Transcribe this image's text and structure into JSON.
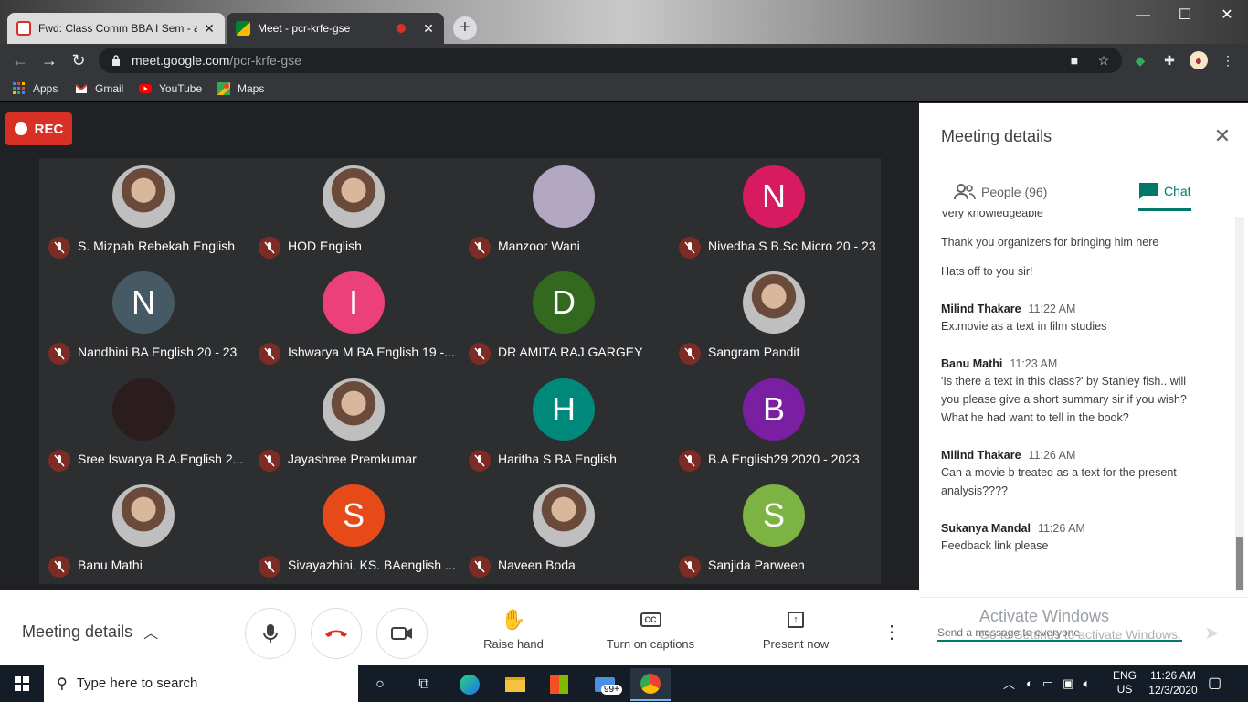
{
  "browser": {
    "tabs": [
      {
        "title": "Fwd: Class Comm BBA I Sem - an",
        "active": false
      },
      {
        "title": "Meet - pcr-krfe-gse",
        "active": true
      }
    ],
    "url_host": "meet.google.com",
    "url_path": "/pcr-krfe-gse",
    "bookmarks": [
      "Apps",
      "Gmail",
      "YouTube",
      "Maps"
    ]
  },
  "meet": {
    "rec_label": "REC",
    "participants": [
      {
        "name": "S. Mizpah Rebekah English",
        "initial": "",
        "color": ""
      },
      {
        "name": "HOD English",
        "initial": "",
        "color": ""
      },
      {
        "name": "Manzoor Wani",
        "initial": "",
        "color": "#b3a8c4"
      },
      {
        "name": "Nivedha.S B.Sc Micro 20 - 23",
        "initial": "N",
        "color": "#d81b60"
      },
      {
        "name": "Nandhini BA English 20 - 23",
        "initial": "N",
        "color": "#455a64"
      },
      {
        "name": "Ishwarya M BA English 19 -...",
        "initial": "I",
        "color": "#ec407a"
      },
      {
        "name": "DR AMITA RAJ GARGEY",
        "initial": "D",
        "color": "#33691e"
      },
      {
        "name": "Sangram Pandit",
        "initial": "",
        "color": ""
      },
      {
        "name": "Sree Iswarya B.A.English 2...",
        "initial": "",
        "color": "#2b1d1d"
      },
      {
        "name": "Jayashree Premkumar",
        "initial": "",
        "color": ""
      },
      {
        "name": "Haritha S BA English",
        "initial": "H",
        "color": "#00897b"
      },
      {
        "name": "B.A English29 2020 - 2023",
        "initial": "B",
        "color": "#7b1fa2"
      },
      {
        "name": "Banu Mathi",
        "initial": "",
        "color": ""
      },
      {
        "name": "Sivayazhini. KS. BAenglish ...",
        "initial": "S",
        "color": "#e64a19"
      },
      {
        "name": "Naveen Boda",
        "initial": "",
        "color": ""
      },
      {
        "name": "Sanjida Parween",
        "initial": "S",
        "color": "#7cb342"
      }
    ]
  },
  "bottombar": {
    "meeting_details": "Meeting details",
    "raise_hand": "Raise hand",
    "captions": "Turn on captions",
    "present": "Present now"
  },
  "panel": {
    "title": "Meeting details",
    "people_tab": "People (96)",
    "chat_tab": "Chat",
    "loose_lines": [
      "Very knowledgeable",
      "Thank you organizers for bringing him here",
      "Hats off to you sir!"
    ],
    "messages": [
      {
        "sender": "Milind Thakare",
        "time": "11:22 AM",
        "lines": [
          "Ex.movie as a text in film studies"
        ]
      },
      {
        "sender": "Banu Mathi",
        "time": "11:23 AM",
        "lines": [
          "'Is there a text in this class?' by Stanley fish.. will",
          "you please give a short summary sir if you wish?",
          "What he had want to tell in the book?"
        ]
      },
      {
        "sender": "Milind Thakare",
        "time": "11:26 AM",
        "lines": [
          "Can a movie b treated as a text for the present",
          "analysis????"
        ]
      },
      {
        "sender": "Sukanya Mandal",
        "time": "11:26 AM",
        "lines": [
          "Feedback link please"
        ]
      }
    ],
    "input_placeholder": "Send a message to everyone",
    "watermark_1": "Activate Windows",
    "watermark_2": "Go to Settings to activate Windows."
  },
  "taskbar": {
    "search_placeholder": "Type here to search",
    "badge": "99+",
    "lang_1": "ENG",
    "lang_2": "US",
    "time": "11:26 AM",
    "date": "12/3/2020"
  }
}
